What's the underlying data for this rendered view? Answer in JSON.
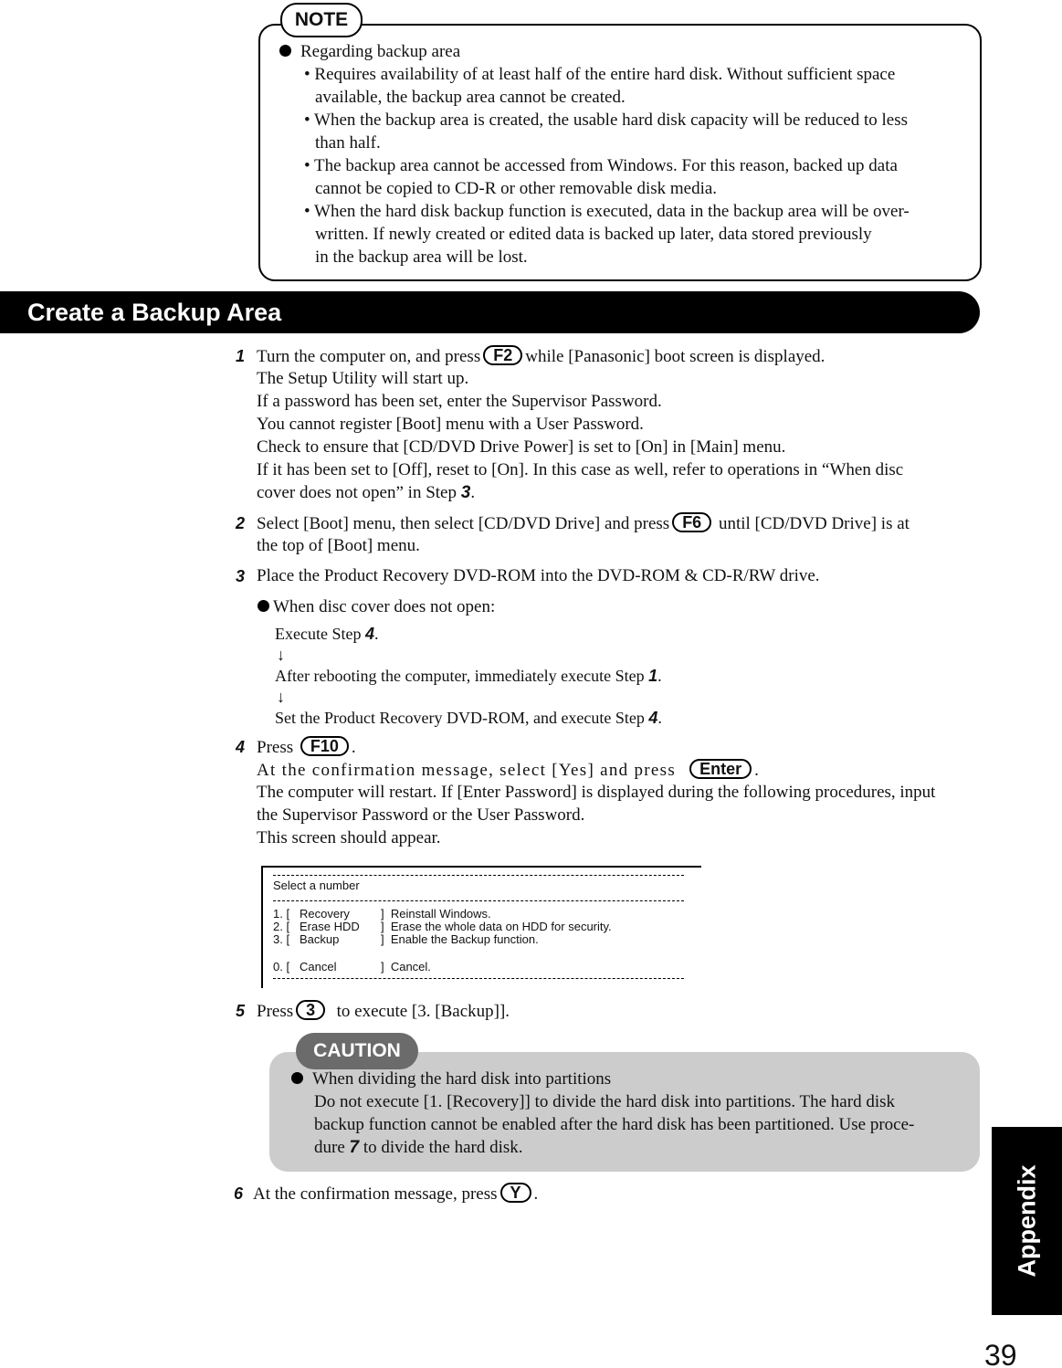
{
  "note": {
    "label": "NOTE",
    "heading": "Regarding backup area",
    "lines": [
      "• Requires availability of at least half of the entire hard disk.  Without sufficient space",
      "available, the backup area cannot be created.",
      "• When the backup area is created, the usable hard disk capacity will be reduced to less",
      "than half.",
      "• The backup area cannot be accessed from Windows.  For this reason, backed up data",
      "cannot be copied to CD-R or other removable disk media.",
      "• When the hard disk backup function is executed, data in the backup area will be over-",
      "written.  If newly created or edited data is backed up later, data stored previously",
      "in the backup area will be lost."
    ]
  },
  "section_title": "Create a Backup Area",
  "steps": {
    "s1": {
      "num": "1",
      "a": "Turn the computer on, and press",
      "key": "F2",
      "b": "while [Panasonic] boot screen is displayed.",
      "lines": [
        "The Setup Utility will start up.",
        "If a password has been set, enter the Supervisor Password.",
        "You cannot register [Boot] menu with a User Password.",
        "Check to ensure that [CD/DVD Drive Power] is set to [On] in [Main] menu.",
        "If it has been set to [Off], reset to [On]. In this case as well, refer to operations in “When disc"
      ],
      "last_a": "cover does not open” in Step",
      "last_ref": "3",
      "last_b": "."
    },
    "s2": {
      "num": "2",
      "a": "Select [Boot] menu, then select [CD/DVD Drive] and press",
      "key": "F6",
      "b": "until [CD/DVD Drive] is at",
      "line2": "the top of [Boot] menu."
    },
    "s3": {
      "num": "3",
      "text": "Place the Product Recovery DVD-ROM into the DVD-ROM & CD-R/RW drive.",
      "bullet": "When disc cover does not open:",
      "flow": [
        {
          "text": "Execute Step",
          "ref": "4"
        },
        {
          "text": "After rebooting the computer, immediately execute Step",
          "ref": "1"
        },
        {
          "text": "Set the Product Recovery DVD-ROM, and execute Step",
          "ref": "4"
        }
      ],
      "arrow": "↓"
    },
    "s4": {
      "num": "4",
      "a": "Press",
      "key": "F10",
      "line2_a": "At the confirmation message, select [Yes] and press",
      "key2": "Enter",
      "lines": [
        "The computer will restart. If [Enter Password] is displayed during the following procedures, input",
        "the Supervisor Password or the User Password.",
        "This screen should appear."
      ]
    },
    "s5": {
      "num": "5",
      "a": "Press",
      "key": "3",
      "b": "to execute [3. [Backup]]."
    },
    "s6": {
      "num": "6",
      "a": "At the confirmation message, press",
      "key": "Y",
      "b": "."
    }
  },
  "screen": {
    "title": "Select a number",
    "options": [
      {
        "n": "1. [",
        "name": "Recovery",
        "desc": "]  Reinstall Windows."
      },
      {
        "n": "2. [",
        "name": "Erase HDD",
        "desc": "]  Erase the whole data on HDD for security."
      },
      {
        "n": "3. [",
        "name": "Backup",
        "desc": "]  Enable the Backup function."
      },
      {
        "n": "0. [",
        "name": "Cancel",
        "desc": "]  Cancel."
      }
    ]
  },
  "caution": {
    "label": "CAUTION",
    "heading": "When dividing the hard disk into partitions",
    "lines": [
      "Do not execute [1. [Recovery]] to divide the hard disk into partitions.  The hard disk",
      "backup function cannot be enabled after the hard disk has been partitioned.  Use proce-"
    ],
    "last_a": "dure",
    "last_ref": "7",
    "last_b": "to divide the hard disk."
  },
  "side_tab": "Appendix",
  "page_number": "39"
}
